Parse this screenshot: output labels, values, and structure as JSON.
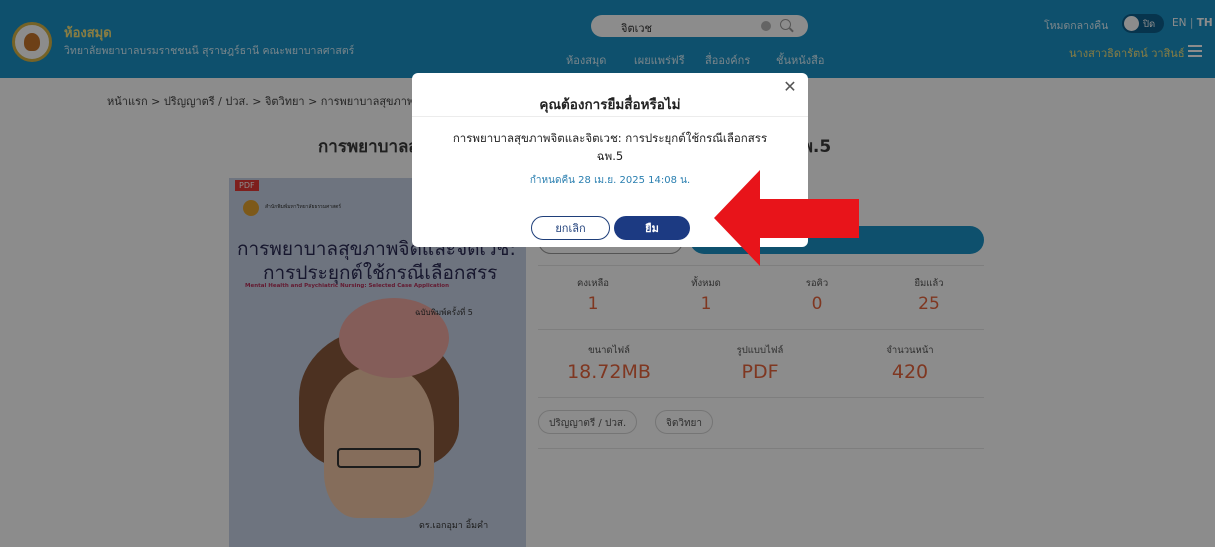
{
  "header": {
    "brand_title": "ห้องสมุด",
    "brand_subtitle": "วิทยาลัยพยาบาลบรมราชชนนี สุราษฎร์ธานี คณะพยาบาลศาสตร์",
    "search_value": "จิตเวช",
    "nav": [
      "ห้องสมุด",
      "เผยแพร่ฟรี",
      "สื่อองค์กร",
      "ชั้นหนังสือ"
    ],
    "dark_mode_label": "โหมดกลางคืน",
    "toggle_label": "ปิด",
    "lang_en": "EN",
    "lang_th": "TH",
    "username": "นางสาวธิดารัตน์ วาสินธ์"
  },
  "breadcrumb": "หน้าแรก > ปริญญาตรี / ปวส. > จิตวิทยา > การพยาบาลสุขภาพ",
  "book": {
    "title": "การพยาบาลสุขภาพจิตและจิตเวช: การประยุกต์ใช้กรณีเลือกสรร ฉพ.5",
    "cover_tag": "PDF",
    "cover_publisher": "สำนักพิมพ์มหาวิทยาลัยธรรมศาสตร์",
    "cover_title_1": "การพยาบาลสุขภาพจิตและจิตเวช:",
    "cover_title_2": "การประยุกต์ใช้กรณีเลือกสรร",
    "cover_en": "Mental Health and Psychiatric Nursing: Selected Case Application",
    "cover_edition": "ฉบับพิมพ์ครั้งที่ 5",
    "cover_author": "ดร.เอกอุมา อิ้มคำ"
  },
  "stats": [
    {
      "label": "คงเหลือ",
      "value": "1"
    },
    {
      "label": "ทั้งหมด",
      "value": "1"
    },
    {
      "label": "รอคิว",
      "value": "0"
    },
    {
      "label": "ยืมแล้ว",
      "value": "25"
    }
  ],
  "file_info": [
    {
      "label": "ขนาดไฟล์",
      "value": "18.72MB"
    },
    {
      "label": "รูปแบบไฟล์",
      "value": "PDF"
    },
    {
      "label": "จำนวนหน้า",
      "value": "420"
    }
  ],
  "tags": [
    "ปริญญาตรี / ปวส.",
    "จิตวิทยา"
  ],
  "modal": {
    "title": "คุณต้องการยืมสื่อหรือไม่",
    "book_name": "การพยาบาลสุขภาพจิตและจิตเวช: การประยุกต์ใช้กรณีเลือกสรร ฉพ.5",
    "due": "กำหนดคืน 28 เม.ย. 2025 14:08 น.",
    "cancel_label": "ยกเลิก",
    "borrow_label": "ยืม"
  },
  "colors": {
    "header": "#1b93c6",
    "accent_orange": "#e8643c",
    "borrow_button": "#1c3a82",
    "annotation_arrow": "#e8141a"
  },
  "icons": [
    "logo-icon",
    "search-icon",
    "clear-icon",
    "menu-icon",
    "close-icon",
    "red-arrow-annotation"
  ]
}
